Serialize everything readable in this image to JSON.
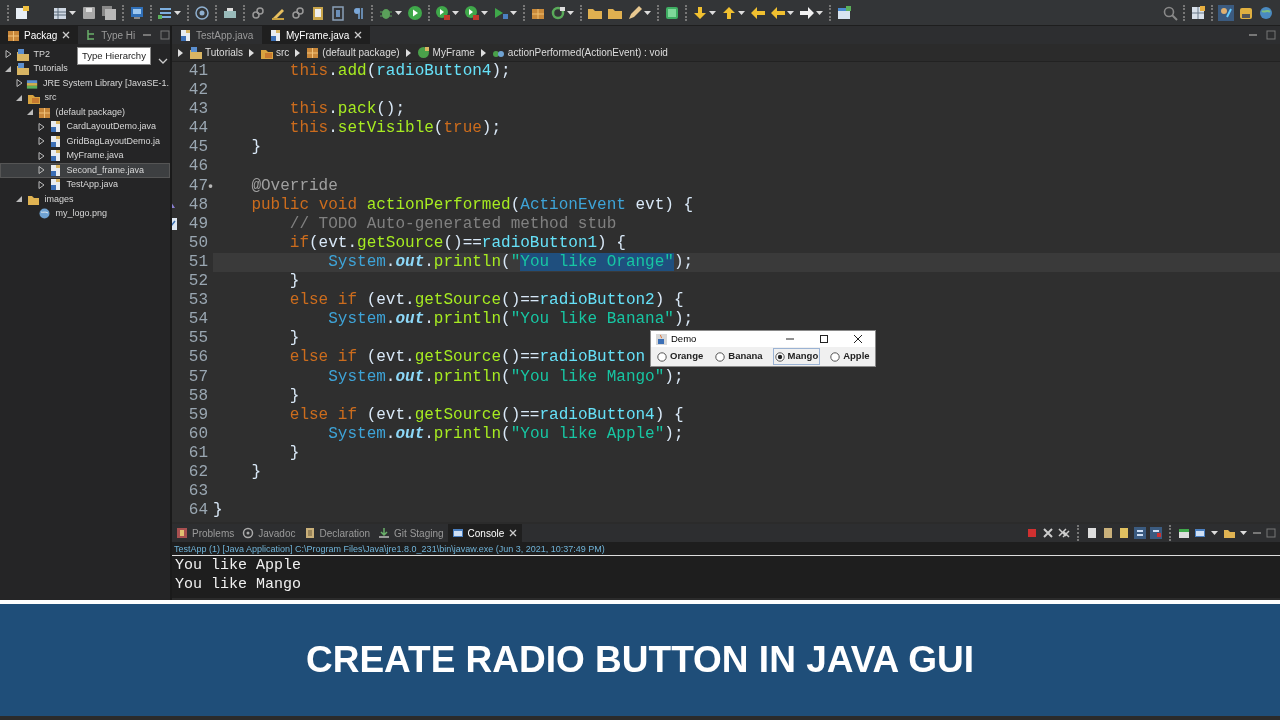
{
  "package_explorer": {
    "tabs": [
      {
        "label": "Packag",
        "selected": true,
        "kind": "package"
      },
      {
        "label": "Type Hi",
        "selected": false,
        "kind": "hierarchy"
      }
    ],
    "tooltip": "Type Hierarchy",
    "tree": [
      {
        "label": "TP2",
        "kind": "project",
        "expanded": false,
        "selected": false
      },
      {
        "label": "Tutorials",
        "kind": "project",
        "expanded": true,
        "selected": false,
        "children": [
          {
            "label": "JRE System Library [JavaSE-1.",
            "kind": "library",
            "expanded": false,
            "selected": false
          },
          {
            "label": "src",
            "kind": "source-folder",
            "expanded": true,
            "selected": false,
            "children": [
              {
                "label": "(default package)",
                "kind": "package",
                "expanded": true,
                "selected": false,
                "children": [
                  {
                    "label": "CardLayoutDemo.java",
                    "kind": "java-file",
                    "expanded": false,
                    "selected": false
                  },
                  {
                    "label": "GridBagLayoutDemo.ja",
                    "kind": "java-file",
                    "expanded": false,
                    "selected": false
                  },
                  {
                    "label": "MyFrame.java",
                    "kind": "java-file",
                    "expanded": false,
                    "selected": false
                  },
                  {
                    "label": "Second_frame.java",
                    "kind": "java-file",
                    "expanded": false,
                    "selected": true
                  },
                  {
                    "label": "TestApp.java",
                    "kind": "java-file",
                    "expanded": false,
                    "selected": false
                  }
                ]
              }
            ]
          },
          {
            "label": "images",
            "kind": "folder",
            "expanded": true,
            "selected": false,
            "children": [
              {
                "label": "my_logo.png",
                "kind": "image",
                "selected": false
              }
            ]
          }
        ]
      }
    ]
  },
  "editor": {
    "tabs": [
      {
        "label": "TestApp.java",
        "selected": false
      },
      {
        "label": "MyFrame.java",
        "selected": true
      }
    ],
    "breadcrumb": [
      {
        "label": "Tutorials",
        "kind": "project"
      },
      {
        "label": "src",
        "kind": "source-folder"
      },
      {
        "label": "(default package)",
        "kind": "package"
      },
      {
        "label": "MyFrame",
        "kind": "class"
      },
      {
        "label": "actionPerformed(ActionEvent) : void",
        "kind": "method"
      }
    ],
    "lines": [
      {
        "number": "41",
        "tokens": [
          {
            "text": "        this",
            "kind": "keyword"
          },
          {
            "text": ".",
            "kind": "plain"
          },
          {
            "text": "add",
            "kind": "method"
          },
          {
            "text": "(",
            "kind": "plain"
          },
          {
            "text": "radioButton4",
            "kind": "field"
          },
          {
            "text": ");",
            "kind": "plain"
          }
        ]
      },
      {
        "number": "42"
      },
      {
        "number": "43",
        "tokens": [
          {
            "text": "        this",
            "kind": "keyword"
          },
          {
            "text": ".",
            "kind": "plain"
          },
          {
            "text": "pack",
            "kind": "method"
          },
          {
            "text": "();",
            "kind": "plain"
          }
        ]
      },
      {
        "number": "44",
        "tokens": [
          {
            "text": "        this",
            "kind": "keyword"
          },
          {
            "text": ".",
            "kind": "plain"
          },
          {
            "text": "setVisible",
            "kind": "method"
          },
          {
            "text": "(",
            "kind": "plain"
          },
          {
            "text": "true",
            "kind": "keyword"
          },
          {
            "text": ");",
            "kind": "plain"
          }
        ]
      },
      {
        "number": "45",
        "tokens": [
          {
            "text": "    }",
            "kind": "plain"
          }
        ]
      },
      {
        "number": "46"
      },
      {
        "number": "47",
        "kind": "dot",
        "tokens": [
          {
            "text": "    @Override",
            "kind": "annotation"
          }
        ]
      },
      {
        "number": "48",
        "kind": "override",
        "tokens": [
          {
            "text": "    public ",
            "kind": "keyword"
          },
          {
            "text": "void ",
            "kind": "keyword"
          },
          {
            "text": "actionPerformed",
            "kind": "method"
          },
          {
            "text": "(",
            "kind": "plain"
          },
          {
            "text": "ActionEvent",
            "kind": "type"
          },
          {
            "text": " evt) {",
            "kind": "plain"
          }
        ]
      },
      {
        "number": "49",
        "kind": "task",
        "tokens": [
          {
            "text": "        // TODO Auto-generated method stub",
            "kind": "comment"
          }
        ]
      },
      {
        "number": "50",
        "tokens": [
          {
            "text": "        if",
            "kind": "keyword"
          },
          {
            "text": "(evt.",
            "kind": "plain"
          },
          {
            "text": "getSource",
            "kind": "method"
          },
          {
            "text": "()==",
            "kind": "plain"
          },
          {
            "text": "radioButton1",
            "kind": "field"
          },
          {
            "text": ") {",
            "kind": "plain"
          }
        ]
      },
      {
        "number": "51",
        "current": true,
        "tokens": [
          {
            "text": "            System",
            "kind": "type"
          },
          {
            "text": ".",
            "kind": "plain"
          },
          {
            "text": "out",
            "kind": "static"
          },
          {
            "text": ".",
            "kind": "plain"
          },
          {
            "text": "println",
            "kind": "method"
          },
          {
            "text": "(",
            "kind": "plain"
          },
          {
            "text": "\"",
            "kind": "string"
          },
          {
            "text": "You like Orange\"",
            "kind": "string",
            "selected": true
          },
          {
            "text": ");",
            "kind": "plain"
          }
        ]
      },
      {
        "number": "52",
        "tokens": [
          {
            "text": "        }",
            "kind": "plain"
          }
        ]
      },
      {
        "number": "53",
        "tokens": [
          {
            "text": "        else ",
            "kind": "keyword"
          },
          {
            "text": "if",
            "kind": "keyword"
          },
          {
            "text": " (evt.",
            "kind": "plain"
          },
          {
            "text": "getSource",
            "kind": "method"
          },
          {
            "text": "()==",
            "kind": "plain"
          },
          {
            "text": "radioButton2",
            "kind": "field"
          },
          {
            "text": ") {",
            "kind": "plain"
          }
        ]
      },
      {
        "number": "54",
        "tokens": [
          {
            "text": "            System",
            "kind": "type"
          },
          {
            "text": ".",
            "kind": "plain"
          },
          {
            "text": "out",
            "kind": "static"
          },
          {
            "text": ".",
            "kind": "plain"
          },
          {
            "text": "println",
            "kind": "method"
          },
          {
            "text": "(",
            "kind": "plain"
          },
          {
            "text": "\"You like Banana\"",
            "kind": "string"
          },
          {
            "text": ");",
            "kind": "plain"
          }
        ]
      },
      {
        "number": "55",
        "tokens": [
          {
            "text": "        }",
            "kind": "plain"
          }
        ]
      },
      {
        "number": "56",
        "tokens": [
          {
            "text": "        else ",
            "kind": "keyword"
          },
          {
            "text": "if",
            "kind": "keyword"
          },
          {
            "text": " (evt.",
            "kind": "plain"
          },
          {
            "text": "getSource",
            "kind": "method"
          },
          {
            "text": "()==",
            "kind": "plain"
          },
          {
            "text": "radioButton",
            "kind": "field"
          }
        ]
      },
      {
        "number": "57",
        "tokens": [
          {
            "text": "            System",
            "kind": "type"
          },
          {
            "text": ".",
            "kind": "plain"
          },
          {
            "text": "out",
            "kind": "static"
          },
          {
            "text": ".",
            "kind": "plain"
          },
          {
            "text": "println",
            "kind": "method"
          },
          {
            "text": "(",
            "kind": "plain"
          },
          {
            "text": "\"You like Mango\"",
            "kind": "string"
          },
          {
            "text": ");",
            "kind": "plain"
          }
        ]
      },
      {
        "number": "58",
        "tokens": [
          {
            "text": "        }",
            "kind": "plain"
          }
        ]
      },
      {
        "number": "59",
        "tokens": [
          {
            "text": "        else ",
            "kind": "keyword"
          },
          {
            "text": "if",
            "kind": "keyword"
          },
          {
            "text": " (evt.",
            "kind": "plain"
          },
          {
            "text": "getSource",
            "kind": "method"
          },
          {
            "text": "()==",
            "kind": "plain"
          },
          {
            "text": "radioButton4",
            "kind": "field"
          },
          {
            "text": ") {",
            "kind": "plain"
          }
        ]
      },
      {
        "number": "60",
        "tokens": [
          {
            "text": "            System",
            "kind": "type"
          },
          {
            "text": ".",
            "kind": "plain"
          },
          {
            "text": "out",
            "kind": "static"
          },
          {
            "text": ".",
            "kind": "plain"
          },
          {
            "text": "println",
            "kind": "method"
          },
          {
            "text": "(",
            "kind": "plain"
          },
          {
            "text": "\"You like Apple\"",
            "kind": "string"
          },
          {
            "text": ");",
            "kind": "plain"
          }
        ]
      },
      {
        "number": "61",
        "tokens": [
          {
            "text": "        }",
            "kind": "plain"
          }
        ]
      },
      {
        "number": "62",
        "tokens": [
          {
            "text": "    }",
            "kind": "plain"
          }
        ]
      },
      {
        "number": "63"
      },
      {
        "number": "64",
        "tokens": [
          {
            "text": "}",
            "kind": "plain"
          }
        ]
      }
    ]
  },
  "demo_window": {
    "title": "Demo",
    "options": [
      {
        "label": "Orange",
        "selected": false,
        "focused": false
      },
      {
        "label": "Banana",
        "selected": false,
        "focused": false
      },
      {
        "label": "Mango",
        "selected": true,
        "focused": true
      },
      {
        "label": "Apple",
        "selected": false,
        "focused": false
      }
    ]
  },
  "console": {
    "tabs": [
      {
        "label": "Problems",
        "kind": "problems",
        "selected": false
      },
      {
        "label": "Javadoc",
        "kind": "javadoc",
        "selected": false
      },
      {
        "label": "Declaration",
        "kind": "declaration",
        "selected": false
      },
      {
        "label": "Git Staging",
        "kind": "git",
        "selected": false
      },
      {
        "label": "Console",
        "kind": "console",
        "selected": true
      }
    ],
    "header": "TestApp (1) [Java Application] C:\\Program Files\\Java\\jre1.8.0_231\\bin\\javaw.exe (Jun 3, 2021, 10:37:49 PM)",
    "output": [
      "You like Apple",
      "You like Mango"
    ]
  },
  "banner": {
    "title": "CREATE RADIO BUTTON IN JAVA GUI"
  }
}
